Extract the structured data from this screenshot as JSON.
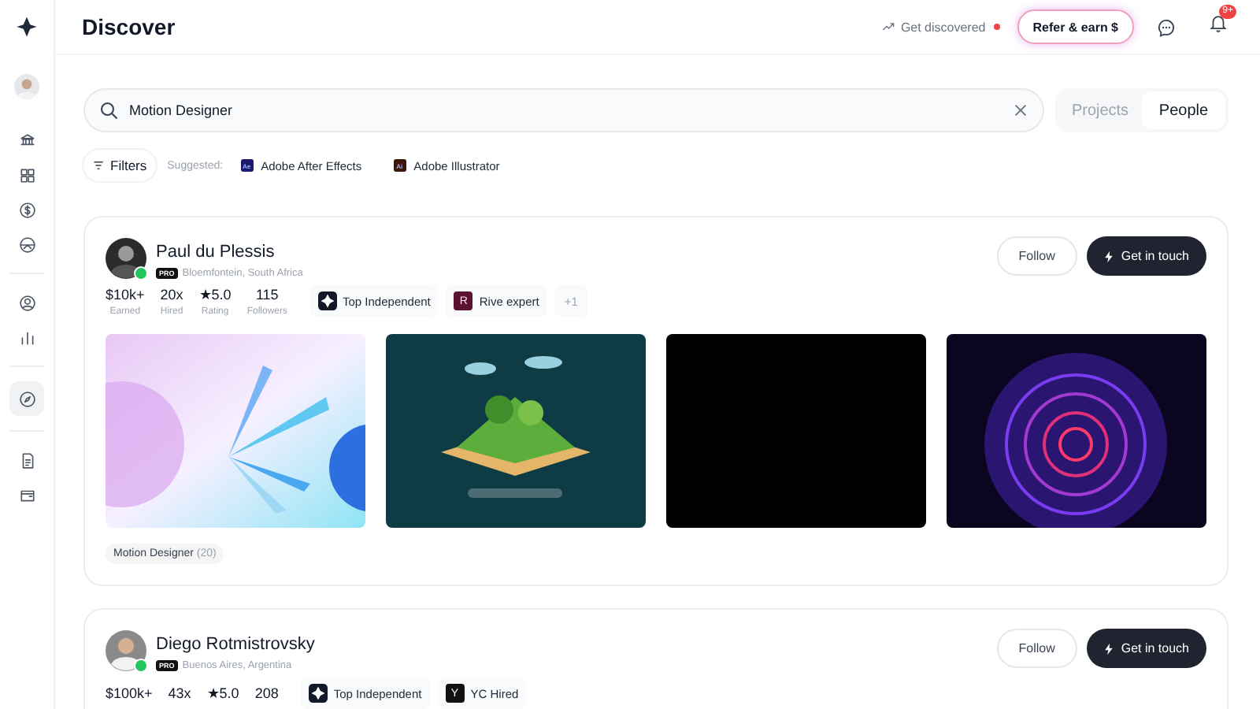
{
  "header": {
    "title": "Discover",
    "get_discovered": "Get discovered",
    "refer_button": "Refer & earn $",
    "notification_count": "9+"
  },
  "sidebar": {
    "items": [
      {
        "selected": false
      },
      {
        "selected": false
      },
      {
        "selected": false
      },
      {
        "selected": false
      },
      {
        "selected": false
      },
      {
        "selected": false
      },
      {
        "selected": true
      },
      {
        "selected": false
      },
      {
        "selected": false
      }
    ]
  },
  "search": {
    "value": "Motion Designer"
  },
  "mode_tabs": [
    {
      "label": "Projects",
      "selected": false
    },
    {
      "label": "People",
      "selected": true
    }
  ],
  "filters": {
    "label": "Filters",
    "suggested_label": "Suggested:",
    "suggestions": [
      {
        "label": "Adobe After Effects",
        "icon_text": "Ae",
        "color": "#1c1a6e"
      },
      {
        "label": "Adobe Illustrator",
        "icon_text": "Ai",
        "color": "#3b1608"
      }
    ]
  },
  "people": [
    {
      "name": "Paul du Plessis",
      "pro": "PRO",
      "location": "Bloemfontein, South Africa",
      "online": true,
      "stats": [
        {
          "value": "$10k+",
          "label": "Earned"
        },
        {
          "value": "20x",
          "label": "Hired"
        },
        {
          "value": "★5.0",
          "label": "Rating"
        },
        {
          "value": "115",
          "label": "Followers"
        }
      ],
      "badges": [
        {
          "label": "Top Independent",
          "kind": "logo"
        },
        {
          "label": "Rive expert",
          "kind": "letter",
          "icon_text": "R"
        }
      ],
      "more": "+1",
      "follow": "Follow",
      "contact": "Get in touch",
      "tag": {
        "label": "Motion Designer",
        "count": "(20)"
      }
    },
    {
      "name": "Diego Rotmistrovsky",
      "pro": "PRO",
      "location": "Buenos Aires, Argentina",
      "online": true,
      "stats": [
        {
          "value": "$100k+"
        },
        {
          "value": "43x"
        },
        {
          "value": "★5.0"
        },
        {
          "value": "208"
        }
      ],
      "badges": [
        {
          "label": "Top Independent",
          "kind": "logo"
        },
        {
          "label": "YC Hired",
          "kind": "letter",
          "icon_text": "Y"
        }
      ],
      "follow": "Follow",
      "contact": "Get in touch"
    }
  ]
}
